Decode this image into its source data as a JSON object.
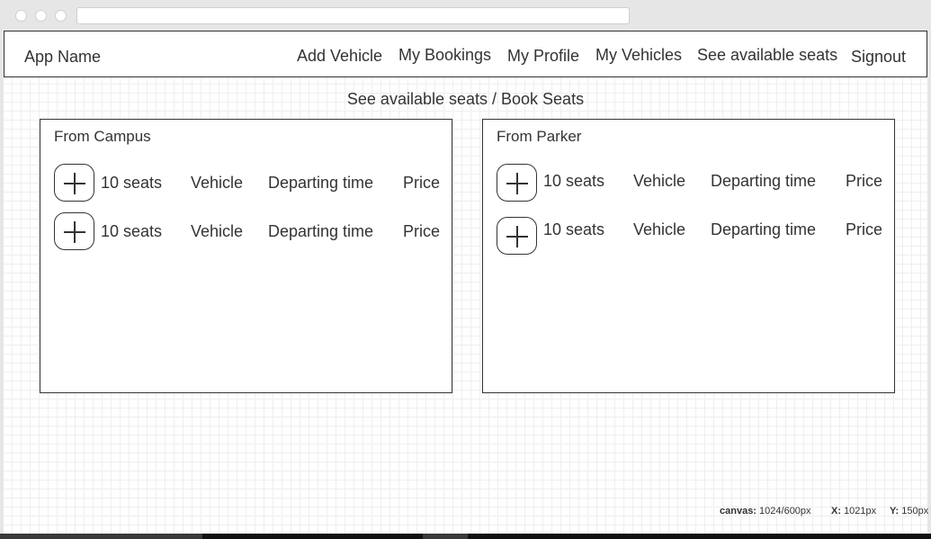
{
  "navbar": {
    "app_name": "App Name",
    "items": [
      {
        "label": "Add Vehicle"
      },
      {
        "label": "My Bookings"
      },
      {
        "label": "My Profile"
      },
      {
        "label": "My Vehicles"
      },
      {
        "label": "See available seats"
      },
      {
        "label": "Signout"
      }
    ]
  },
  "page_title": "See available seats / Book Seats",
  "panels": [
    {
      "title": "From Campus",
      "rows": [
        {
          "seats": "10 seats",
          "vehicle": "Vehicle",
          "departing": "Departing time",
          "price": "Price"
        },
        {
          "seats": "10 seats",
          "vehicle": "Vehicle",
          "departing": "Departing time",
          "price": "Price"
        }
      ]
    },
    {
      "title": "From Parker",
      "rows": [
        {
          "seats": "10 seats",
          "vehicle": "Vehicle",
          "departing": "Departing time",
          "price": "Price"
        },
        {
          "seats": "10 seats",
          "vehicle": "Vehicle",
          "departing": "Departing time",
          "price": "Price"
        }
      ]
    }
  ],
  "status_bar": {
    "canvas_label": "canvas:",
    "canvas_value": "1024/600px",
    "x_label": "X:",
    "x_value": "1021px",
    "y_label": "Y:",
    "y_value": "150px"
  },
  "icons": {
    "add": "plus-icon"
  }
}
